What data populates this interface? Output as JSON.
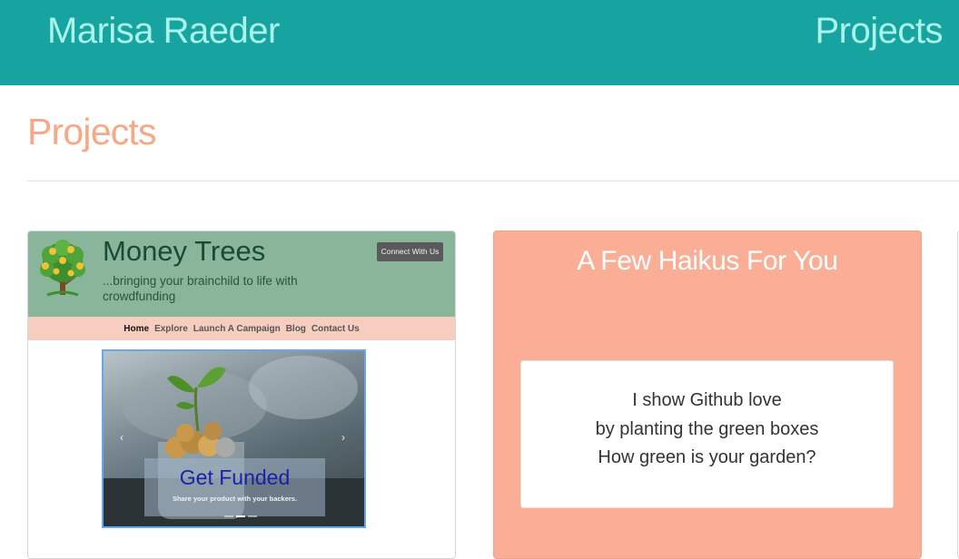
{
  "navbar": {
    "brand": "Marisa Raeder",
    "link_projects": "Projects"
  },
  "page": {
    "section_title": "Projects"
  },
  "projects": [
    {
      "screenshot": {
        "title": "Money Trees",
        "tagline": "...bringing your brainchild to life with crowdfunding",
        "connect_button": "Connect With Us",
        "nav": [
          "Home",
          "Explore",
          "Launch A Campaign",
          "Blog",
          "Contact Us"
        ],
        "carousel": {
          "caption_title": "Get Funded",
          "caption_subtitle": "Share your product with your backers.",
          "prev_glyph": "‹",
          "next_glyph": "›"
        }
      }
    },
    {
      "title": "A Few Haikus For You",
      "haiku": [
        "I show Github love",
        "by planting the green boxes",
        "How green is your garden?"
      ]
    }
  ],
  "colors": {
    "navbar_bg": "#17a4a0",
    "navbar_text": "#a9f3e9",
    "section_title": "#f7a884",
    "haiku_card_bg": "#fbae96",
    "money_trees_header": "#89b69a",
    "money_trees_nav": "#f6cdbe"
  },
  "icons": {
    "money_tree_logo": "money-tree-logo-icon",
    "carousel_prev": "chevron-left-icon",
    "carousel_next": "chevron-right-icon"
  }
}
